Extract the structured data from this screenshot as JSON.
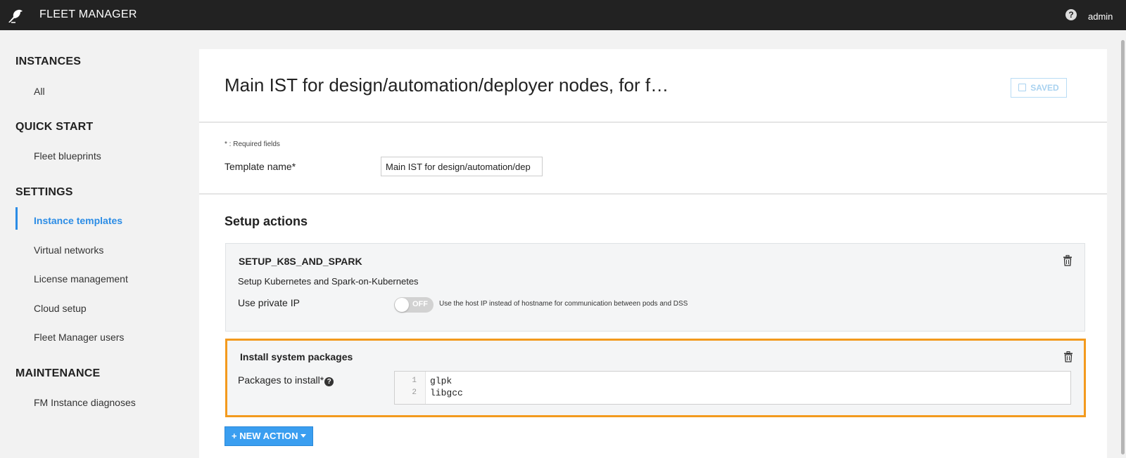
{
  "topbar": {
    "app_title": "FLEET MANAGER",
    "user": "admin",
    "help_icon": "?",
    "logo_icon": "bird-logo-icon"
  },
  "sidebar": {
    "sections": [
      {
        "title": "INSTANCES",
        "items": [
          "All"
        ]
      },
      {
        "title": "QUICK START",
        "items": [
          "Fleet blueprints"
        ]
      },
      {
        "title": "SETTINGS",
        "items": [
          "Instance templates",
          "Virtual networks",
          "License management",
          "Cloud setup",
          "Fleet Manager users"
        ]
      },
      {
        "title": "MAINTENANCE",
        "items": [
          "FM Instance diagnoses"
        ]
      }
    ],
    "active_item": "Instance templates",
    "active_color": "#2b8ce5"
  },
  "header": {
    "page_title": "Main IST for design/automation/deployer nodes, for f…",
    "saved_label": "SAVED"
  },
  "form": {
    "required_note": "* : Required fields",
    "template_name_label": "Template name*",
    "template_name_value": "Main IST for design/automation/dep"
  },
  "setup_actions": {
    "heading": "Setup actions",
    "actions": [
      {
        "title": "SETUP_K8S_AND_SPARK",
        "description": "Setup Kubernetes and Spark-on-Kubernetes",
        "option_label": "Use private IP",
        "toggle_state": "OFF",
        "toggle_help": "Use the host IP instead of hostname for communication between pods and DSS"
      },
      {
        "title": "Install system packages",
        "packages_label": "Packages to install*",
        "packages": [
          "glpk",
          "libgcc"
        ],
        "line_numbers": [
          "1",
          "2"
        ],
        "highlight_color": "#f39a1e"
      }
    ],
    "new_action_label": "+ NEW ACTION"
  }
}
